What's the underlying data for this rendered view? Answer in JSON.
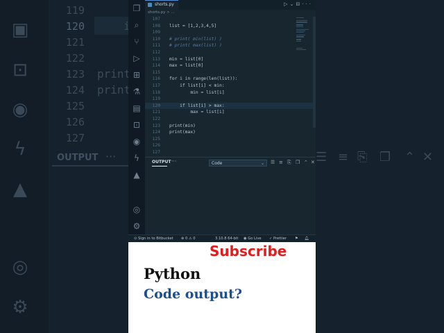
{
  "editor": {
    "tab_label": "shorts.py",
    "breadcrumb": "shorts.py > ...",
    "lines": [
      {
        "num": "107",
        "text": ""
      },
      {
        "num": "108",
        "text": "list = [1,2,3,4,5]"
      },
      {
        "num": "109",
        "text": ""
      },
      {
        "num": "110",
        "text": "# print( min(list) )"
      },
      {
        "num": "111",
        "text": "# print( max(list) )"
      },
      {
        "num": "112",
        "text": ""
      },
      {
        "num": "113",
        "text": "min = list[0]"
      },
      {
        "num": "114",
        "text": "max = list[0]"
      },
      {
        "num": "115",
        "text": ""
      },
      {
        "num": "116",
        "text": "for i in range(len(list)):"
      },
      {
        "num": "117",
        "text": "    if list[i] < min:"
      },
      {
        "num": "118",
        "text": "        min = list[i]"
      },
      {
        "num": "119",
        "text": ""
      },
      {
        "num": "120",
        "text": "    if list[i] > max:"
      },
      {
        "num": "121",
        "text": "        max = list[i]"
      },
      {
        "num": "122",
        "text": ""
      },
      {
        "num": "123",
        "text": "print(min)"
      },
      {
        "num": "124",
        "text": "print(max)"
      },
      {
        "num": "125",
        "text": ""
      },
      {
        "num": "126",
        "text": ""
      },
      {
        "num": "127",
        "text": ""
      }
    ]
  },
  "panel": {
    "tab_label": "OUTPUT",
    "more": "···",
    "channel": "Code"
  },
  "statusbar": {
    "bitbucket": "Sign in to Bitbucket",
    "problems": "⊗ 0 ⚠ 0",
    "python_version": "3.10.8 64-bit",
    "go_live": "Go Live",
    "prettier": "Prettier"
  },
  "overlay": {
    "subscribe": "Subscribe",
    "title": "Python",
    "subtitle": "Code output?"
  },
  "background": {
    "line_numbers": [
      "119",
      "120",
      "121",
      "122",
      "123",
      "124",
      "125",
      "126",
      "127"
    ],
    "code_fragments": [
      "i",
      "print",
      "print"
    ],
    "output_label": "OUTPUT",
    "dots": "···"
  },
  "colors": {
    "accent": "#5a8fd6",
    "subscribe_red": "#e01e1e",
    "subtitle_blue": "#1c4f8f"
  }
}
